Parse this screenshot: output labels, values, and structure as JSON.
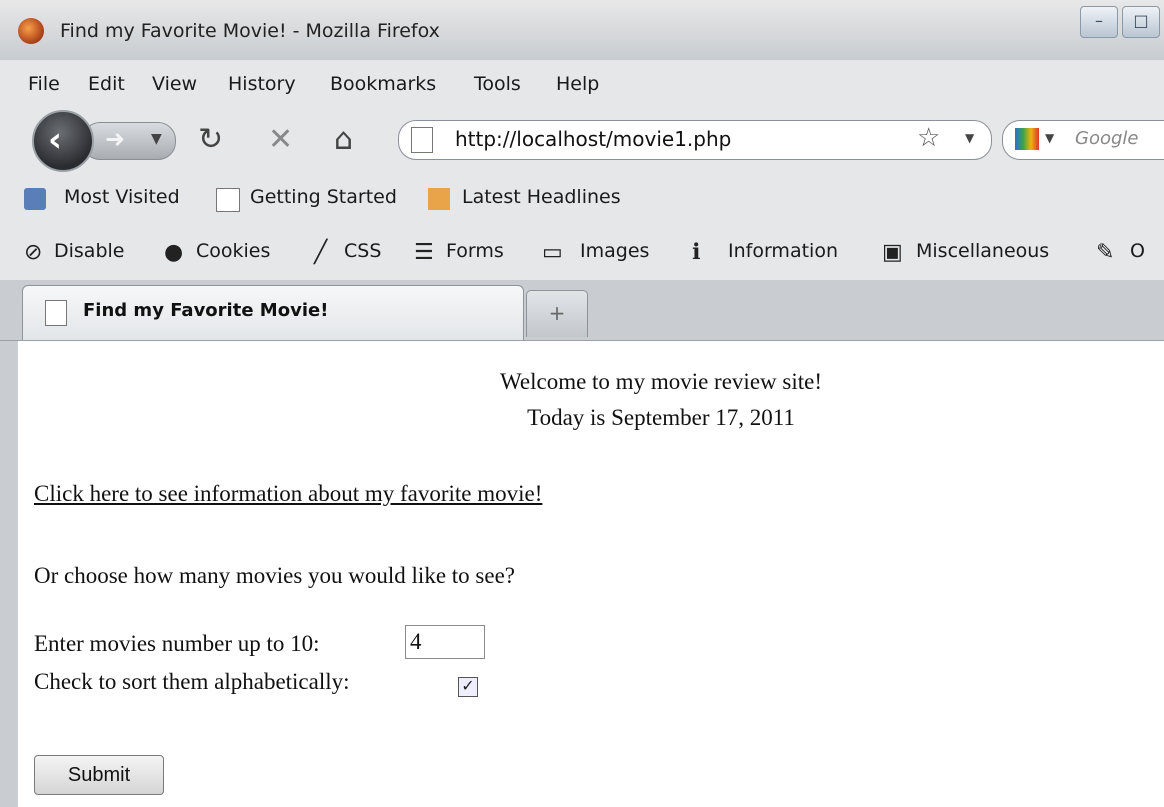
{
  "window": {
    "title": "Find my Favorite Movie! - Mozilla Firefox",
    "minimize_icon": "minimize-icon",
    "maximize_icon": "maximize-icon"
  },
  "menu": {
    "items": [
      "File",
      "Edit",
      "View",
      "History",
      "Bookmarks",
      "Tools",
      "Help"
    ]
  },
  "nav": {
    "url": "http://localhost/movie1.php",
    "search_placeholder": "Google"
  },
  "bookmarks": {
    "items": [
      "Most Visited",
      "Getting Started",
      "Latest Headlines"
    ]
  },
  "devtoolbar": {
    "items": [
      "Disable",
      "Cookies",
      "CSS",
      "Forms",
      "Images",
      "Information",
      "Miscellaneous",
      "O"
    ]
  },
  "tabs": {
    "active_title": "Find my Favorite Movie!",
    "new_tab_symbol": "+"
  },
  "page": {
    "welcome": "Welcome to my movie review site!",
    "today": "Today is September 17, 2011",
    "link": "Click here to see information about my favorite movie!",
    "choose": "Or choose how many movies you would like to see?",
    "enter_label": "Enter movies number up to 10:",
    "enter_value": "4",
    "sort_label": "Check to sort them alphabetically:",
    "sort_checked": true,
    "submit_label": "Submit"
  }
}
